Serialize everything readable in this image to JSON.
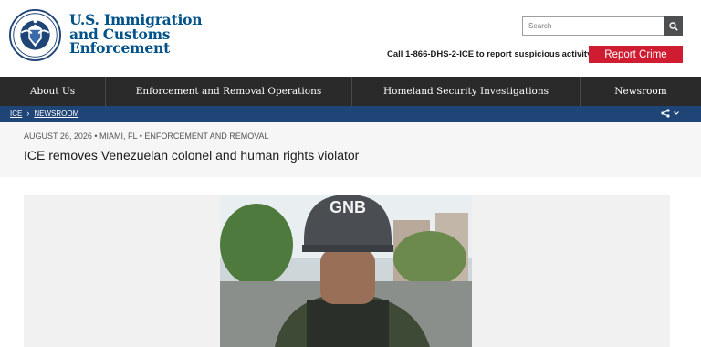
{
  "header": {
    "agency_line1": "U.S. Immigration",
    "agency_line2": "and Customs",
    "agency_line3": "Enforcement",
    "seal_icon": "dhs-seal-icon",
    "search": {
      "placeholder": "Search",
      "value": ""
    },
    "tip_prefix": "Call ",
    "tip_phone": "1-866-DHS-2-ICE",
    "tip_suffix": " to report suspicious activity",
    "report_label": "Report Crime"
  },
  "nav": {
    "items": [
      {
        "label": "About Us"
      },
      {
        "label": "Enforcement and Removal Operations"
      },
      {
        "label": "Homeland Security Investigations"
      },
      {
        "label": "Newsroom"
      }
    ]
  },
  "breadcrumb": {
    "items": [
      {
        "label": "ICE"
      },
      {
        "label": "NEWSROOM"
      }
    ],
    "separator": "›",
    "share_icon": "share-icon"
  },
  "article": {
    "meta": "AUGUST 26, 2026 • MIAMI, FL • ENFORCEMENT AND REMOVAL",
    "title": "ICE removes Venezuelan colonel and human rights violator",
    "photo_helmet_text": "GNB"
  },
  "colors": {
    "brand_blue": "#005288",
    "nav_bg": "#2a2a2b",
    "crumb_bar": "#1f4476",
    "report_red": "#d01c30"
  }
}
